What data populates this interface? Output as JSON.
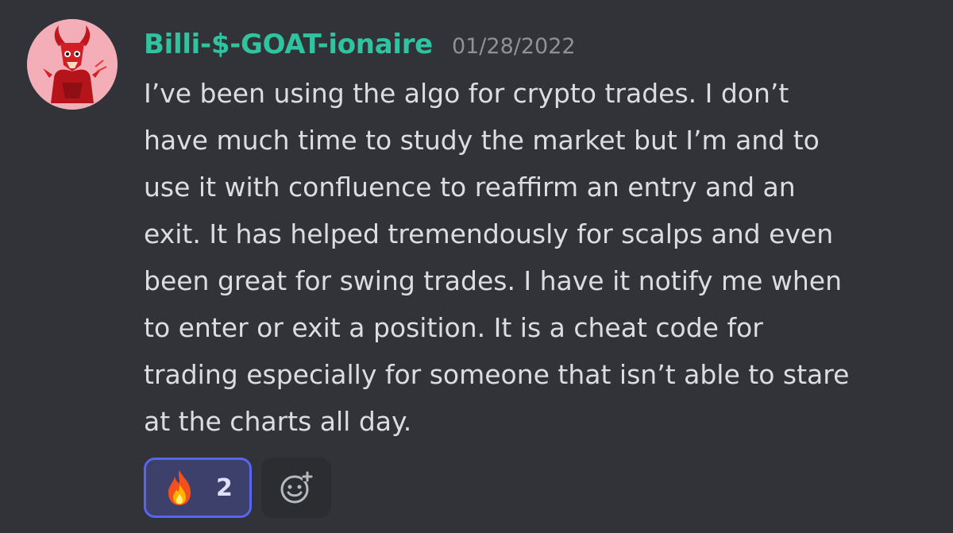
{
  "message": {
    "author": "Billi-$-GOAT-ionaire",
    "timestamp": "01/28/2022",
    "lines": [
      "I’ve been using the algo for crypto trades. I don’t",
      "have much time to study the market but I’m and to",
      "use it with confluence to reaffirm an entry and an",
      "exit. It has helped tremendously for scalps and even",
      "been great for swing trades. I have it notify me when",
      "to enter or exit a position. It is a cheat code for",
      "trading especially for someone that isn’t able to stare",
      "at the charts all day."
    ]
  },
  "reactions": [
    {
      "emoji": "fire-icon",
      "count": "2",
      "selected": true
    }
  ],
  "add_reaction": {
    "icon": "add-emoji-icon"
  },
  "colors": {
    "background": "#313338",
    "username": "#2fc39f",
    "timestamp": "#8e9297",
    "text": "#dcdde0",
    "reaction_border": "#5865f2",
    "avatar_bg": "#f3aeb8"
  }
}
